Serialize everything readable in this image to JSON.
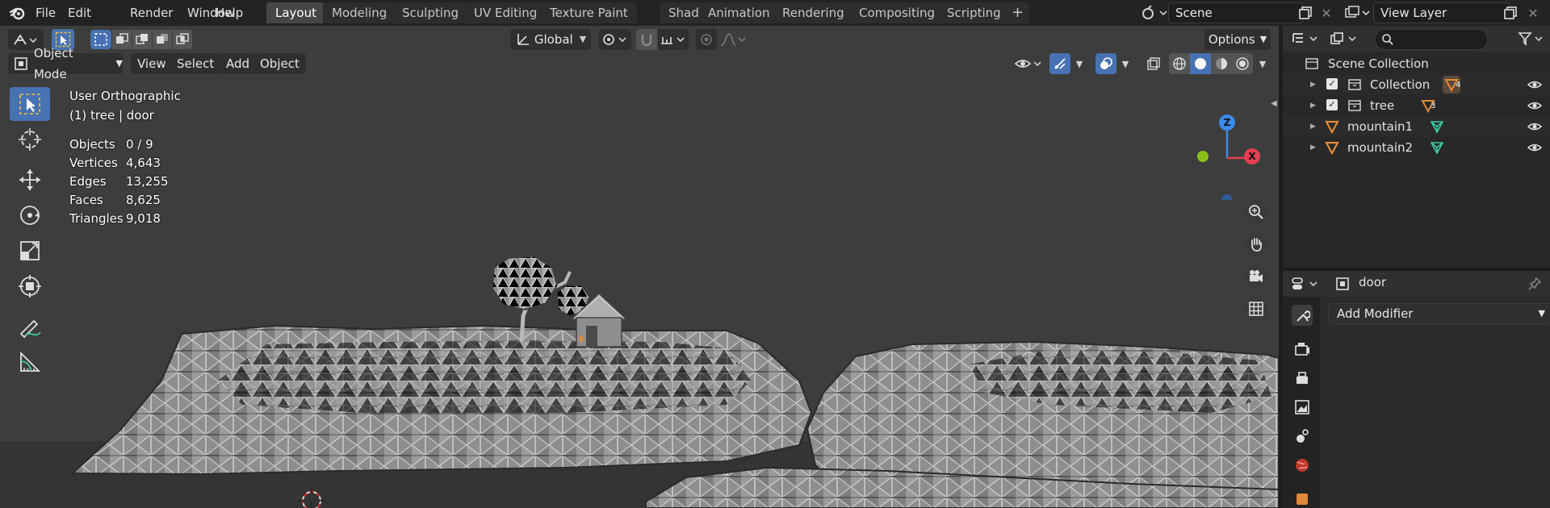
{
  "top_menu": [
    "File",
    "Edit",
    "Render",
    "Window",
    "Help"
  ],
  "workspace_tabs": [
    {
      "label": "Layout",
      "active": true
    },
    {
      "label": "Modeling",
      "active": false
    },
    {
      "label": "Sculpting",
      "active": false
    },
    {
      "label": "UV Editing",
      "active": false
    },
    {
      "label": "Texture Paint",
      "active": false
    },
    {
      "label": "Shading",
      "active": false
    },
    {
      "label": "Animation",
      "active": false
    },
    {
      "label": "Rendering",
      "active": false
    },
    {
      "label": "Compositing",
      "active": false
    },
    {
      "label": "Scripting",
      "active": false
    }
  ],
  "add_workspace_glyph": "+",
  "scene": {
    "label": "Scene"
  },
  "view_layer": {
    "label": "View Layer"
  },
  "viewport_header": {
    "transform_orientation": "Global",
    "options_label": "Options",
    "mode": "Object Mode",
    "menus": [
      "View",
      "Select",
      "Add",
      "Object"
    ]
  },
  "overlay": {
    "view_name": "User Orthographic",
    "context": "(1) tree | door",
    "stats": [
      {
        "label": "Objects",
        "value": "0 / 9"
      },
      {
        "label": "Vertices",
        "value": "4,643"
      },
      {
        "label": "Edges",
        "value": "13,255"
      },
      {
        "label": "Faces",
        "value": "8,625"
      },
      {
        "label": "Triangles",
        "value": "9,018"
      }
    ]
  },
  "gizmo": {
    "z": "Z",
    "x": "X"
  },
  "outliner": {
    "search_placeholder": "",
    "root": "Scene Collection",
    "rows": [
      {
        "label": "Collection",
        "badge": "4",
        "type": "collection",
        "checked": true
      },
      {
        "label": "tree",
        "badge": "3",
        "type": "collection",
        "checked": true
      },
      {
        "label": "mountain1",
        "type": "mesh"
      },
      {
        "label": "mountain2",
        "type": "mesh"
      }
    ]
  },
  "properties": {
    "object_name": "door",
    "add_modifier": "Add Modifier"
  },
  "colors": {
    "accent_blue": "#4772b3",
    "axis_x": "#e44051",
    "axis_y": "#8ac21a",
    "axis_z": "#3b89e8",
    "object_orange": "#e08a3a",
    "mesh_green": "#3fc7a4"
  }
}
